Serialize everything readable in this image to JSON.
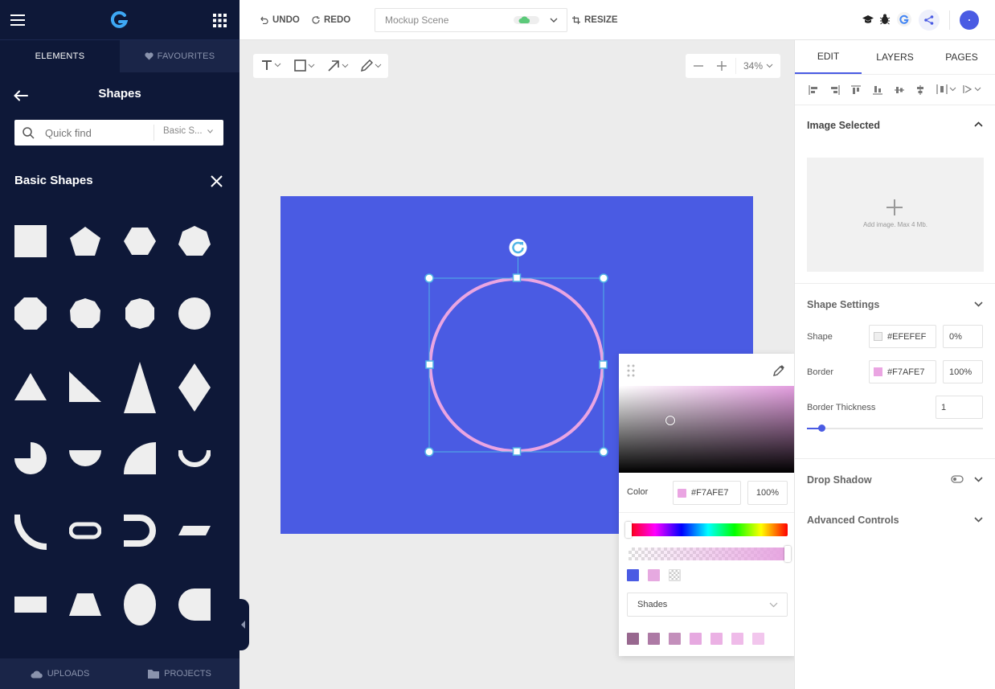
{
  "sidebar": {
    "tabs": [
      "ELEMENTS",
      "FAVOURITES"
    ],
    "title": "Shapes",
    "search": {
      "placeholder": "Quick find",
      "filter": "Basic S..."
    },
    "section_title": "Basic Shapes",
    "bottom": [
      "UPLOADS",
      "PROJECTS"
    ]
  },
  "topbar": {
    "undo": "UNDO",
    "redo": "REDO",
    "scene": "Mockup Scene",
    "resize": "RESIZE"
  },
  "canvas": {
    "zoom": "34%",
    "artboard_color": "#4a5be3",
    "circle_border_color": "#F7AFE7"
  },
  "picker": {
    "color_label": "Color",
    "hex": "#F7AFE7",
    "opacity": "100%",
    "presets": [
      "#4a5be3",
      "#e6a9e0",
      "transparent"
    ],
    "shades_label": "Shades",
    "shades": [
      "#98688f",
      "#ad7aa5",
      "#c38fbb",
      "#e6a9e0",
      "#ebb1e4",
      "#efbbe9",
      "#f2c6ed"
    ]
  },
  "right": {
    "tabs": [
      "EDIT",
      "LAYERS",
      "PAGES"
    ],
    "image_section": "Image Selected",
    "add_image": "Add image. Max 4 Mb.",
    "shape_settings": "Shape Settings",
    "shape_label": "Shape",
    "shape_color": "#EFEFEF",
    "shape_opacity": "0%",
    "border_label": "Border",
    "border_color": "#F7AFE7",
    "border_opacity": "100%",
    "thickness_label": "Border Thickness",
    "thickness_value": "1",
    "drop_shadow": "Drop Shadow",
    "advanced": "Advanced Controls"
  }
}
